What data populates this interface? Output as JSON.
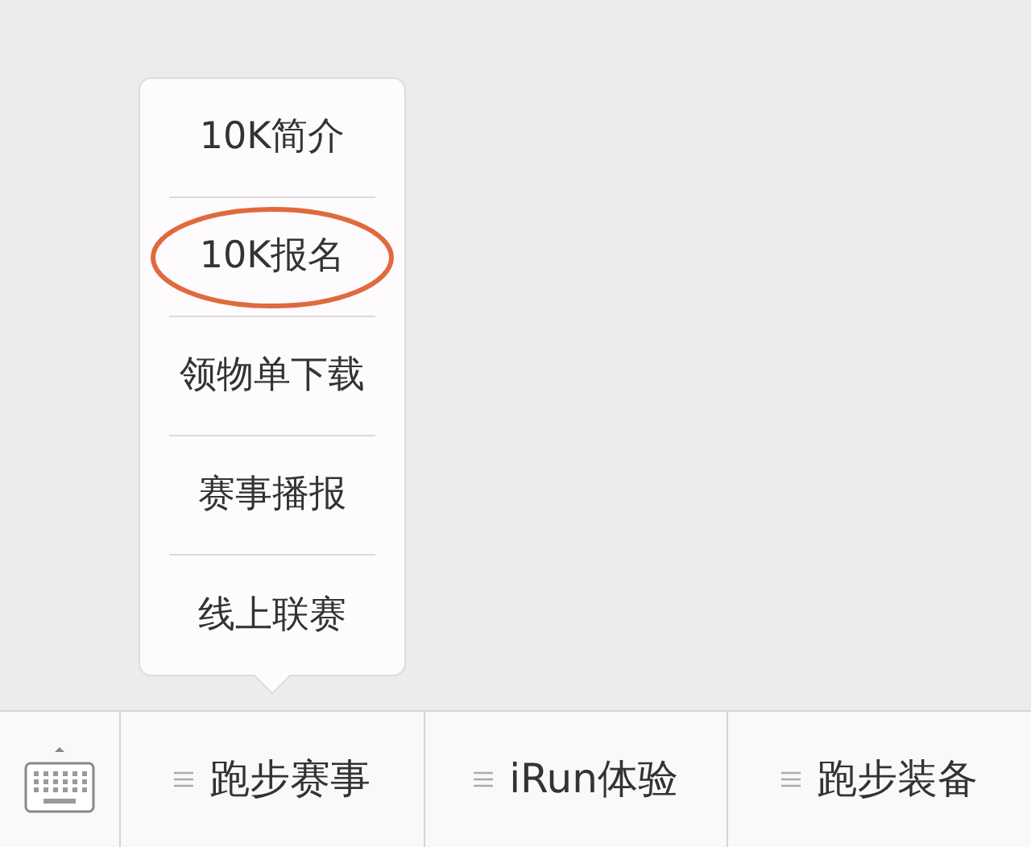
{
  "menu_bar": {
    "items": [
      {
        "label": "跑步赛事",
        "submenu": [
          {
            "label": "10K简介",
            "circled": false
          },
          {
            "label": "10K报名",
            "circled": true
          },
          {
            "label": "领物单下载",
            "circled": false
          },
          {
            "label": "赛事播报",
            "circled": false
          },
          {
            "label": "线上联赛",
            "circled": false
          }
        ]
      },
      {
        "label": "iRun体验"
      },
      {
        "label": "跑步装备"
      }
    ]
  }
}
